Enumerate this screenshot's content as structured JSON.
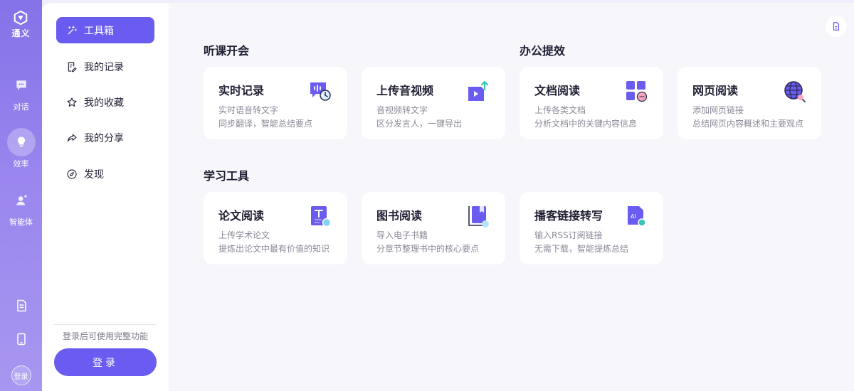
{
  "rail": {
    "logo_label": "通义",
    "items": [
      {
        "label": "对话",
        "icon": "chat-icon"
      },
      {
        "label": "效率",
        "icon": "lightbulb-icon"
      },
      {
        "label": "智能体",
        "icon": "agent-icon"
      }
    ],
    "bottom_icons": [
      "document-icon",
      "tablet-icon"
    ],
    "avatar_label": "登录"
  },
  "sidebar": {
    "items": [
      {
        "label": "工具箱",
        "icon": "magic-wand-icon",
        "active": true
      },
      {
        "label": "我的记录",
        "icon": "note-edit-icon"
      },
      {
        "label": "我的收藏",
        "icon": "star-icon"
      },
      {
        "label": "我的分享",
        "icon": "share-icon"
      },
      {
        "label": "发现",
        "icon": "compass-icon"
      }
    ],
    "login_hint": "登录后可使用完整功能",
    "login_button": "登录"
  },
  "main": {
    "sections": [
      {
        "title": "听课开会",
        "cards": [
          {
            "title": "实时记录",
            "desc1": "实时语音转文字",
            "desc2": "同步翻译，智能总结要点",
            "icon": "realtime-record-icon"
          },
          {
            "title": "上传音视频",
            "desc1": "音视频转文字",
            "desc2": "区分发言人，一键导出",
            "icon": "upload-video-icon"
          }
        ]
      },
      {
        "title": "办公提效",
        "cards": [
          {
            "title": "文档阅读",
            "desc1": "上传各类文档",
            "desc2": "分析文档中的关键内容信息",
            "icon": "document-grid-icon"
          },
          {
            "title": "网页阅读",
            "desc1": "添加网页链接",
            "desc2": "总结网页内容概述和主要观点",
            "icon": "globe-icon"
          }
        ]
      },
      {
        "title": "学习工具",
        "cards": [
          {
            "title": "论文阅读",
            "desc1": "上传学术论文",
            "desc2": "提炼出论文中最有价值的知识",
            "icon": "paper-icon"
          },
          {
            "title": "图书阅读",
            "desc1": "导入电子书籍",
            "desc2": "分章节整理书中的核心要点",
            "icon": "book-icon"
          },
          {
            "title": "播客链接转写",
            "desc1": "输入RSS订阅链接",
            "desc2": "无需下载，智能提炼总结",
            "icon": "podcast-ai-icon"
          }
        ]
      }
    ]
  },
  "colors": {
    "accent": "#6a5cf0",
    "rail_top": "#8472e8",
    "main_bg": "#f6f6fb"
  }
}
